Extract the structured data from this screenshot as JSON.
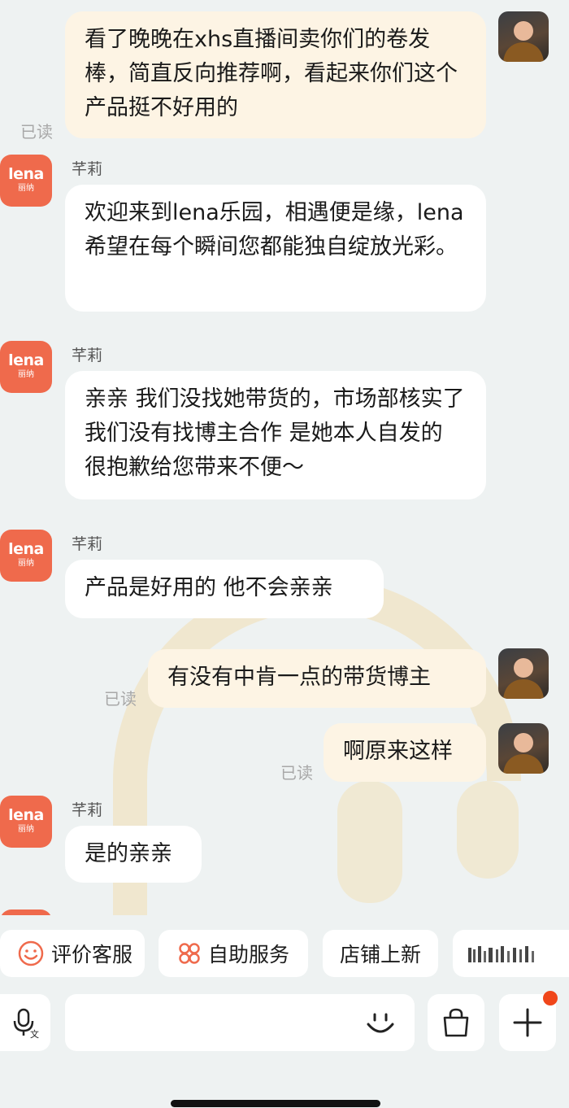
{
  "messages": [
    {
      "side": "out",
      "text": "看了晚晚在xhs直播间卖你们的卷发棒，简直反向推荐啊，看起来你们这个产品挺不好用的",
      "status": "已读"
    },
    {
      "side": "in",
      "sender": "芊莉",
      "text": "欢迎来到lena乐园，相遇便是缘，lena希望在每个瞬间您都能独自绽放光彩。"
    },
    {
      "side": "in",
      "sender": "芊莉",
      "text": "亲亲 我们没找她带货的，市场部核实了 我们没有找博主合作 是她本人自发的 很抱歉给您带来不便～"
    },
    {
      "side": "in",
      "sender": "芊莉",
      "text": "产品是好用的 他不会亲亲"
    },
    {
      "side": "out",
      "text": "有没有中肯一点的带货博主",
      "status": "已读"
    },
    {
      "side": "out",
      "text": "啊原来这样",
      "status": "已读"
    },
    {
      "side": "in",
      "sender": "芊莉",
      "text": "是的亲亲"
    }
  ],
  "brand": {
    "logo_text": "lena",
    "logo_cn": "丽纳",
    "color": "#ef6a4c"
  },
  "quick_actions": [
    {
      "label": "评价客服",
      "icon": "smiley-icon"
    },
    {
      "label": "自助服务",
      "icon": "grid-icon"
    },
    {
      "label": "店铺上新",
      "icon": ""
    },
    {
      "label": "",
      "icon": "more-icon"
    }
  ],
  "input": {
    "placeholder": "",
    "voice_icon": "microphone-icon",
    "emoji_icon": "emoji-icon",
    "bag_icon": "shopping-bag-icon",
    "plus_icon": "plus-icon"
  },
  "colors": {
    "page_bg": "#eef2f2",
    "incoming_bubble": "#ffffff",
    "outgoing_bubble": "#fdf4e4",
    "notify_dot": "#f0461a"
  }
}
